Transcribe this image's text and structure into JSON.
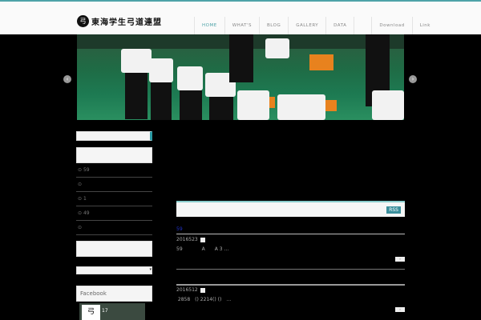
{
  "site": {
    "logo_text": "東海学生弓道連盟",
    "logo_mark": "弓"
  },
  "nav": [
    "HOME",
    "WHAT'S",
    "BLOG",
    "GALLERY",
    "DATA",
    "",
    "Download",
    "Link"
  ],
  "slider": {
    "prev": "‹",
    "next": "›"
  },
  "sidebar": {
    "items": [
      "59",
      "",
      "1",
      "49",
      ""
    ],
    "facebook": "Facebook",
    "fb_count": "17"
  },
  "main": {
    "rss": "RSS",
    "section": "59",
    "posts": [
      {
        "date": "2016523",
        "excerpt": "59　　　　A　　A 3 …"
      },
      {
        "date": "2016512",
        "excerpt": " 2858　() 2214() ()　…"
      }
    ],
    "more": "»"
  }
}
